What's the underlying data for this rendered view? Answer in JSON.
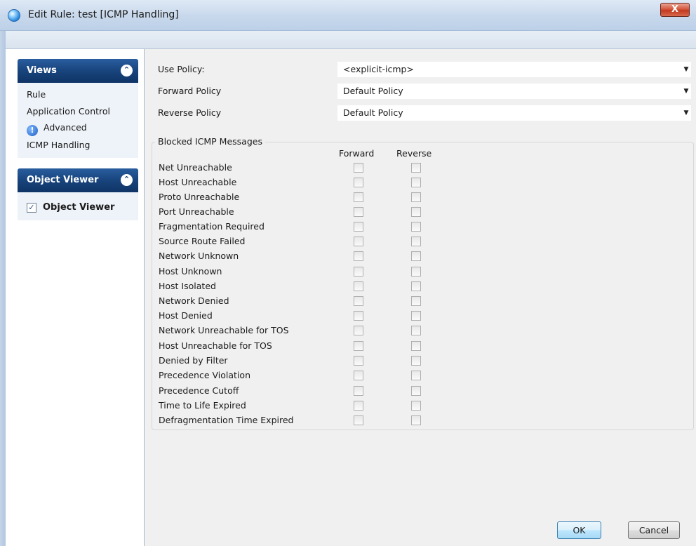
{
  "window": {
    "title": "Edit Rule: test [ICMP Handling]",
    "close_label": "X"
  },
  "nav": {
    "views": {
      "title": "Views",
      "items": [
        {
          "label": "Rule"
        },
        {
          "label": "Application Control"
        },
        {
          "label": "Advanced",
          "icon": "info-icon"
        },
        {
          "label": "ICMP Handling"
        }
      ]
    },
    "object_viewer": {
      "title": "Object Viewer",
      "checkbox_label": "Object Viewer",
      "checked": true
    }
  },
  "policies": [
    {
      "label": "Use Policy:",
      "value": "<explicit-icmp>"
    },
    {
      "label": "Forward Policy",
      "value": "Default Policy"
    },
    {
      "label": "Reverse Policy",
      "value": "Default Policy"
    }
  ],
  "blocked_icmp": {
    "title": "Blocked ICMP Messages",
    "columns": [
      "Forward",
      "Reverse"
    ],
    "messages": [
      "Net Unreachable",
      "Host Unreachable",
      "Proto Unreachable",
      "Port Unreachable",
      "Fragmentation Required",
      "Source Route Failed",
      "Network Unknown",
      "Host Unknown",
      "Host Isolated",
      "Network Denied",
      "Host Denied",
      "Network Unreachable for TOS",
      "Host Unreachable for TOS",
      "Denied by Filter",
      "Precedence Violation",
      "Precedence Cutoff",
      "Time to Life Expired",
      "Defragmentation Time Expired"
    ]
  },
  "buttons": {
    "ok": "OK",
    "cancel": "Cancel"
  }
}
